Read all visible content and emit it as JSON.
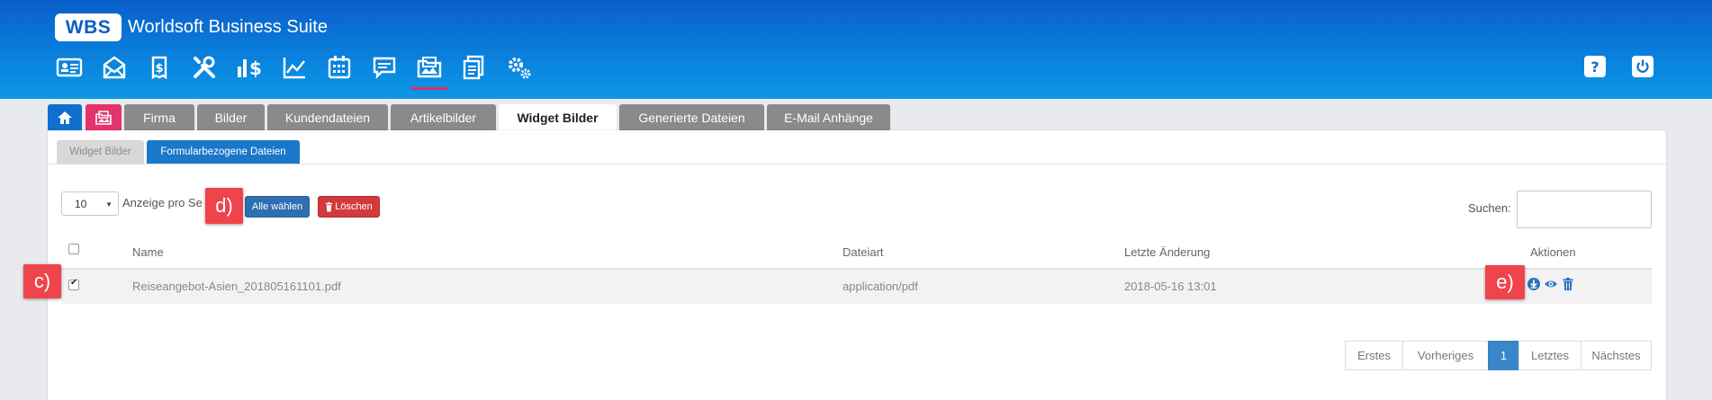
{
  "header": {
    "logo": "WBS",
    "title": "Worldsoft Business Suite",
    "toolbar": [
      {
        "icon": "contact-card-icon"
      },
      {
        "icon": "mail-bulk-icon"
      },
      {
        "icon": "invoice-dollar-icon"
      },
      {
        "icon": "tools-icon"
      },
      {
        "icon": "dollar-chart-icon"
      },
      {
        "icon": "line-chart-icon"
      },
      {
        "icon": "calendar-icon"
      },
      {
        "icon": "chat-icon"
      },
      {
        "icon": "folder-images-icon",
        "active": true
      },
      {
        "icon": "documents-icon"
      },
      {
        "icon": "gears-icon"
      }
    ],
    "help_icon": "help-icon",
    "power_icon": "power-icon"
  },
  "tabs": [
    {
      "label": "",
      "icon": "home-icon"
    },
    {
      "label": "",
      "icon": "folder-images-icon"
    },
    {
      "label": "Firma"
    },
    {
      "label": "Bilder"
    },
    {
      "label": "Kundendateien"
    },
    {
      "label": "Artikelbilder"
    },
    {
      "label": "Widget Bilder",
      "active": true
    },
    {
      "label": "Generierte Dateien"
    },
    {
      "label": "E-Mail Anhänge"
    }
  ],
  "subtabs": [
    {
      "label": "Widget Bilder"
    },
    {
      "label": "Formularbezogene Dateien",
      "active": true
    }
  ],
  "controls": {
    "per_page_value": "10",
    "per_page_label": "Anzeige pro Se",
    "select_all": "Alle wählen",
    "delete": "Löschen",
    "search_label": "Suchen:",
    "search_value": ""
  },
  "table": {
    "columns": [
      "Name",
      "Dateiart",
      "Letzte Änderung",
      "Aktionen"
    ],
    "rows": [
      {
        "checked": true,
        "name": "Reiseangebot-Asien_201805161101.pdf",
        "type": "application/pdf",
        "modified": "2018-05-16 13:01",
        "actions": [
          "download-icon",
          "view-icon",
          "trash-icon"
        ]
      }
    ]
  },
  "pagination": [
    "Erstes",
    "Vorheriges",
    "1",
    "Letztes",
    "Nächstes"
  ],
  "pagination_active": "1",
  "callouts": {
    "c": "c)",
    "d": "d)",
    "e": "e)"
  },
  "colors": {
    "header_top": "#0b5ec9",
    "header_bottom": "#0b98e6",
    "accent_pink": "#e2336b",
    "primary_blue": "#2e6fb2",
    "danger_red": "#d23b3b",
    "callout_red": "#f0444c"
  }
}
